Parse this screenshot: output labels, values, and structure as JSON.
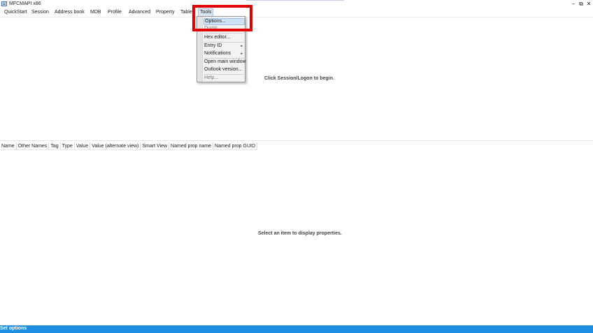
{
  "window": {
    "title": "MFCMAPI x86",
    "controls": {
      "minimize": "–",
      "restore": "⧉",
      "close": "✕"
    }
  },
  "menubar": {
    "items": [
      {
        "label": "QuickStart"
      },
      {
        "label": "Session"
      },
      {
        "label": "Address book"
      },
      {
        "label": "MDB"
      },
      {
        "label": "Profile"
      },
      {
        "label": "Advanced"
      },
      {
        "label": "Property"
      },
      {
        "label": "Table"
      },
      {
        "label": "Tools",
        "active": true
      }
    ]
  },
  "tools_menu": {
    "items": [
      {
        "label": "Options...",
        "highlighted": true
      },
      {
        "label": "Dump..."
      },
      {
        "label": "Hex editor..."
      },
      {
        "label": "Entry ID",
        "submenu": "▸"
      },
      {
        "label": "Notifications",
        "submenu": "▸"
      },
      {
        "label": "Open main window"
      },
      {
        "label": "Outlook version..."
      },
      {
        "label": "Help..."
      }
    ]
  },
  "upper_pane": {
    "message": "Click Session/Logon to begin."
  },
  "properties_table": {
    "columns": [
      "Name",
      "Other Names",
      "Tag",
      "Type",
      "Value",
      "Value (alternate view)",
      "Smart View",
      "Named prop name",
      "Named prop GUID"
    ],
    "empty_message": "Select an item to display properties."
  },
  "statusbar": {
    "text": "Set options"
  },
  "colors": {
    "status_bar": "#1e8fe0",
    "highlight_box": "#e00000",
    "menu_highlight": "#cfe1f6"
  }
}
